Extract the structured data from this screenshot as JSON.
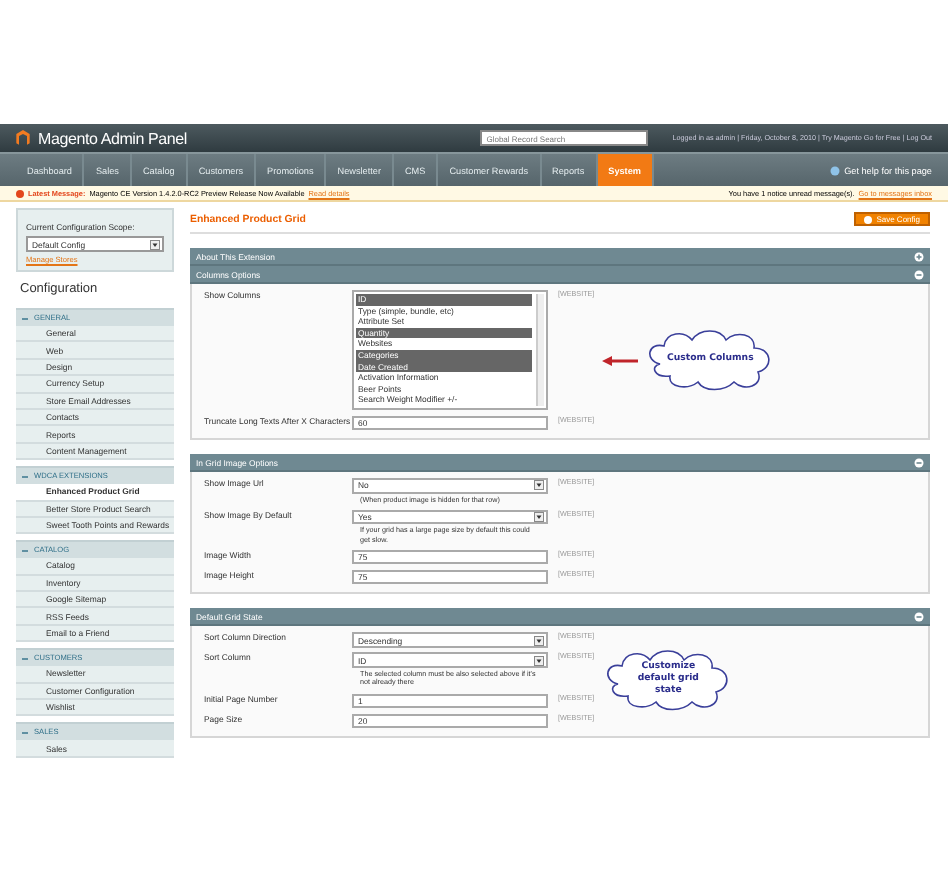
{
  "header": {
    "logo": "Magento Admin Panel",
    "search": {
      "placeholder": "Global Record Search"
    },
    "user_links": "Logged in as admin | Friday, October 8, 2010 | Try Magento Go for Free | Log Out"
  },
  "nav": {
    "items": [
      {
        "label": "Dashboard",
        "selected": false
      },
      {
        "label": "Sales",
        "selected": false
      },
      {
        "label": "Catalog",
        "selected": false
      },
      {
        "label": "Customers",
        "selected": false
      },
      {
        "label": "Promotions",
        "selected": false
      },
      {
        "label": "Newsletter",
        "selected": false
      },
      {
        "label": "CMS",
        "selected": false
      },
      {
        "label": "Customer Rewards",
        "selected": false
      },
      {
        "label": "Reports",
        "selected": false
      },
      {
        "label": "System",
        "selected": true
      }
    ],
    "help": "Get help for this page"
  },
  "message": {
    "label": "Latest Message:",
    "text": "Magento CE Version 1.4.2.0-RC2 Preview Release Now Available",
    "link": "Read details",
    "notice": "You have 1 notice unread message(s).",
    "notice_link": "Go to messages inbox"
  },
  "sidebar": {
    "scope_label": "Current Configuration Scope:",
    "scope_value": "Default Config",
    "manage_link": "Manage Stores",
    "heading": "Configuration",
    "groups": [
      {
        "title": "GENERAL",
        "items": [
          {
            "label": "General",
            "selected": false
          },
          {
            "label": "Web",
            "selected": false
          },
          {
            "label": "Design",
            "selected": false
          },
          {
            "label": "Currency Setup",
            "selected": false
          },
          {
            "label": "Store Email Addresses",
            "selected": false
          },
          {
            "label": "Contacts",
            "selected": false
          },
          {
            "label": "Reports",
            "selected": false
          },
          {
            "label": "Content Management",
            "selected": false
          }
        ]
      },
      {
        "title": "WDCA EXTENSIONS",
        "items": [
          {
            "label": "Enhanced Product Grid",
            "selected": true
          },
          {
            "label": "Better Store Product Search",
            "selected": false
          },
          {
            "label": "Sweet Tooth Points and Rewards",
            "selected": false
          }
        ]
      },
      {
        "title": "CATALOG",
        "items": [
          {
            "label": "Catalog",
            "selected": false
          },
          {
            "label": "Inventory",
            "selected": false
          },
          {
            "label": "Google Sitemap",
            "selected": false
          },
          {
            "label": "RSS Feeds",
            "selected": false
          },
          {
            "label": "Email to a Friend",
            "selected": false
          }
        ]
      },
      {
        "title": "CUSTOMERS",
        "items": [
          {
            "label": "Newsletter",
            "selected": false
          },
          {
            "label": "Customer Configuration",
            "selected": false
          },
          {
            "label": "Wishlist",
            "selected": false
          }
        ]
      },
      {
        "title": "SALES",
        "items": [
          {
            "label": "Sales",
            "selected": false
          }
        ]
      }
    ]
  },
  "main": {
    "title": "Enhanced Product Grid",
    "save_button": "Save Config",
    "sections": [
      {
        "title": "About This Extension",
        "expanded": false
      },
      {
        "title": "Columns Options",
        "expanded": true,
        "fields": [
          {
            "kind": "multiselect",
            "label": "Show Columns",
            "scope": "[WEBSITE]",
            "options": [
              {
                "label": "ID",
                "selected": true
              },
              {
                "label": "Type (simple, bundle, etc)",
                "selected": false
              },
              {
                "label": "Attribute Set",
                "selected": false
              },
              {
                "label": "Quantity",
                "selected": true
              },
              {
                "label": "Websites",
                "selected": false
              },
              {
                "label": "Categories",
                "selected": true
              },
              {
                "label": "Date Created",
                "selected": true
              },
              {
                "label": "Activation Information",
                "selected": false
              },
              {
                "label": "Beer Points",
                "selected": false
              },
              {
                "label": "Search Weight Modifier +/-",
                "selected": false
              }
            ]
          },
          {
            "kind": "text",
            "label": "Truncate Long Texts After X Characters",
            "value": "60",
            "scope": "[WEBSITE]"
          }
        ],
        "callout": {
          "text": "Custom Columns",
          "arrow": true
        }
      },
      {
        "title": "In Grid Image Options",
        "expanded": true,
        "fields": [
          {
            "kind": "select",
            "label": "Show Image Url",
            "value": "No",
            "note": "(When product image is hidden for that row)",
            "scope": "[WEBSITE]"
          },
          {
            "kind": "select",
            "label": "Show Image By Default",
            "value": "Yes",
            "note": "If your grid has a large page size by default this could get slow.",
            "scope": "[WEBSITE]"
          },
          {
            "kind": "text",
            "label": "Image Width",
            "value": "75",
            "scope": "[WEBSITE]"
          },
          {
            "kind": "text",
            "label": "Image Height",
            "value": "75",
            "scope": "[WEBSITE]"
          }
        ]
      },
      {
        "title": "Default Grid State",
        "expanded": true,
        "fields": [
          {
            "kind": "select",
            "label": "Sort Column Direction",
            "value": "Descending",
            "scope": "[WEBSITE]"
          },
          {
            "kind": "select",
            "label": "Sort Column",
            "value": "ID",
            "note": "The selected column must be also selected above if it's not already there",
            "scope": "[WEBSITE]"
          },
          {
            "kind": "text",
            "label": "Initial Page Number",
            "value": "1",
            "scope": "[WEBSITE]"
          },
          {
            "kind": "text",
            "label": "Page Size",
            "value": "20",
            "scope": "[WEBSITE]"
          }
        ],
        "callout": {
          "text": "Customize default grid state",
          "arrow": false
        }
      }
    ]
  }
}
